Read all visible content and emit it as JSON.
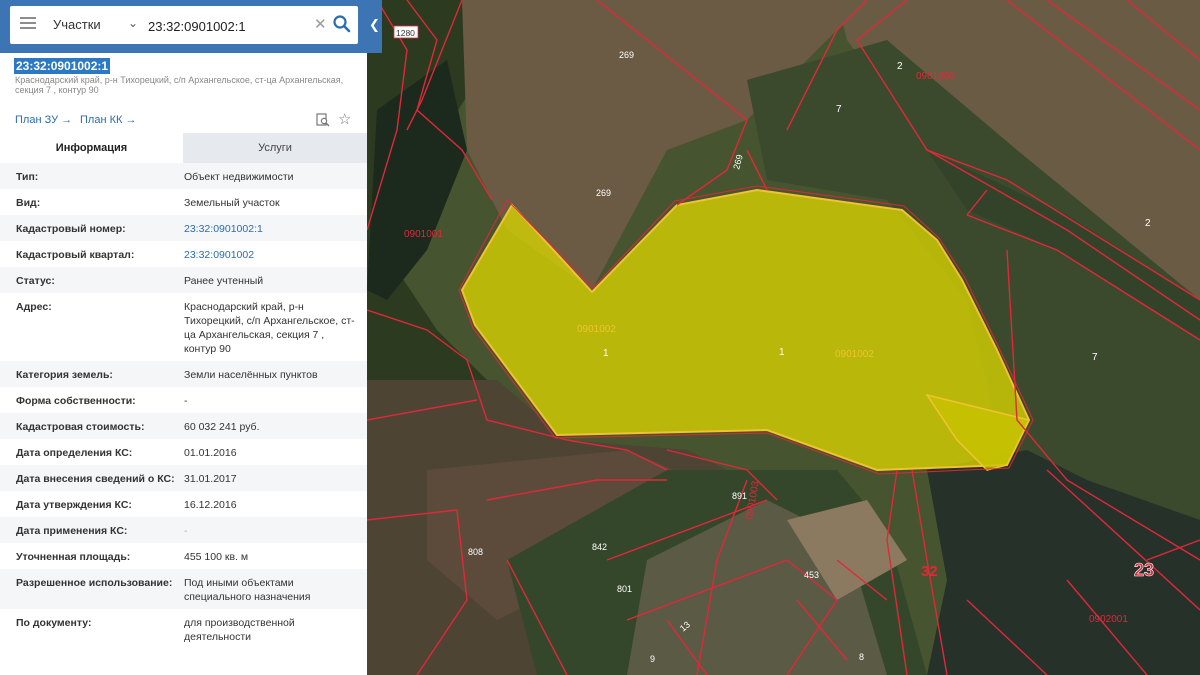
{
  "search": {
    "category": "Участки",
    "query": "23:32:0901002:1"
  },
  "object": {
    "number": "23:32:0901002:1",
    "address": "Краснодарский край, р-н Тихорецкий, с/п Архангельское, ст-ца Архангельская, секция 7 , контур 90",
    "plan_zu": "План ЗУ",
    "plan_kk": "План КК"
  },
  "tabs": [
    {
      "label": "Информация",
      "active": true
    },
    {
      "label": "Услуги",
      "active": false
    }
  ],
  "info": [
    {
      "label": "Тип:",
      "value": "Объект недвижимости"
    },
    {
      "label": "Вид:",
      "value": "Земельный участок"
    },
    {
      "label": "Кадастровый номер:",
      "value": "23:32:0901002:1"
    },
    {
      "label": "Кадастровый квартал:",
      "value": "23:32:0901002"
    },
    {
      "label": "Статус:",
      "value": "Ранее учтенный"
    },
    {
      "label": "Адрес:",
      "value": "Краснодарский край, р-н Тихорецкий, с/п Архангельское, ст-ца Архангельская, секция 7 , контур 90"
    },
    {
      "label": "Категория земель:",
      "value": "Земли населённых пунктов"
    },
    {
      "label": "Форма собственности:",
      "value": "-"
    },
    {
      "label": "Кадастровая стоимость:",
      "value": "60 032 241 руб."
    },
    {
      "label": "Дата определения КС:",
      "value": "01.01.2016"
    },
    {
      "label": "Дата внесения сведений о КС:",
      "value": "31.01.2017"
    },
    {
      "label": "Дата утверждения КС:",
      "value": "16.12.2016"
    },
    {
      "label": "Дата применения КС:",
      "value": "-"
    },
    {
      "label": "Уточненная площадь:",
      "value": "455 100 кв. м"
    },
    {
      "label": "Разрешенное использование:",
      "value": "Под иными объектами специального назначения"
    },
    {
      "label": "По документу:",
      "value": "для производственной деятельности"
    }
  ],
  "map_labels": {
    "l1280": "1280",
    "l269a": "269",
    "l269b": "269",
    "l269c": "269",
    "l2a": "2",
    "l2b": "2",
    "l0901003": "0901003",
    "l7a": "7",
    "l7b": "7",
    "l0901001": "0901001",
    "l0901002a": "0901002",
    "l0901002b": "0901002",
    "l1a": "1",
    "l1b": "1",
    "l891": "891",
    "l0901003v": "0901003",
    "l808": "808",
    "l842": "842",
    "l801": "801",
    "l453": "453",
    "l32": "32",
    "l23": "23",
    "l0902001": "0902001",
    "l13": "13",
    "l8": "8",
    "l9": "9"
  },
  "colors": {
    "accent": "#3d74b4",
    "link": "#2b6cb0",
    "parcel_fill": "#d9d400",
    "boundary": "#e0283a"
  }
}
